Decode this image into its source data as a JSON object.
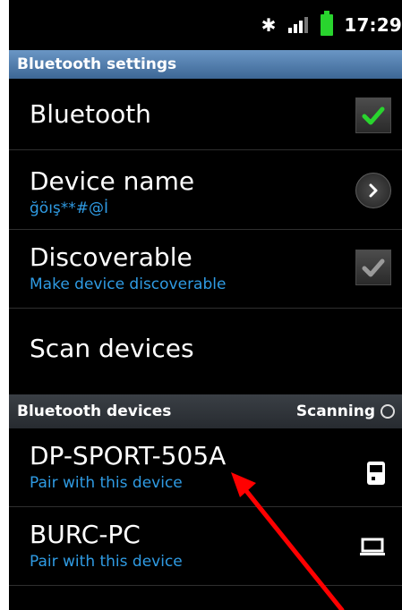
{
  "status_bar": {
    "time": "17:29"
  },
  "header": {
    "title": "Bluetooth settings"
  },
  "settings": {
    "bluetooth": {
      "label": "Bluetooth",
      "checked": true
    },
    "device_name": {
      "label": "Device name",
      "value": "ğöış**#@İ"
    },
    "discoverable": {
      "label": "Discoverable",
      "sub": "Make device discoverable",
      "checked": true
    },
    "scan": {
      "label": "Scan devices"
    }
  },
  "devices_section": {
    "title": "Bluetooth devices",
    "status": "Scanning"
  },
  "devices": [
    {
      "name": "DP-SPORT-505A",
      "sub": "Pair with this device",
      "icon": "phone-icon"
    },
    {
      "name": "BURC-PC",
      "sub": "Pair with this device",
      "icon": "laptop-icon"
    }
  ],
  "colors": {
    "accent": "#2f9be3",
    "header": "#4f7fb2",
    "check_green": "#29d42e",
    "arrow": "#ff0000"
  }
}
